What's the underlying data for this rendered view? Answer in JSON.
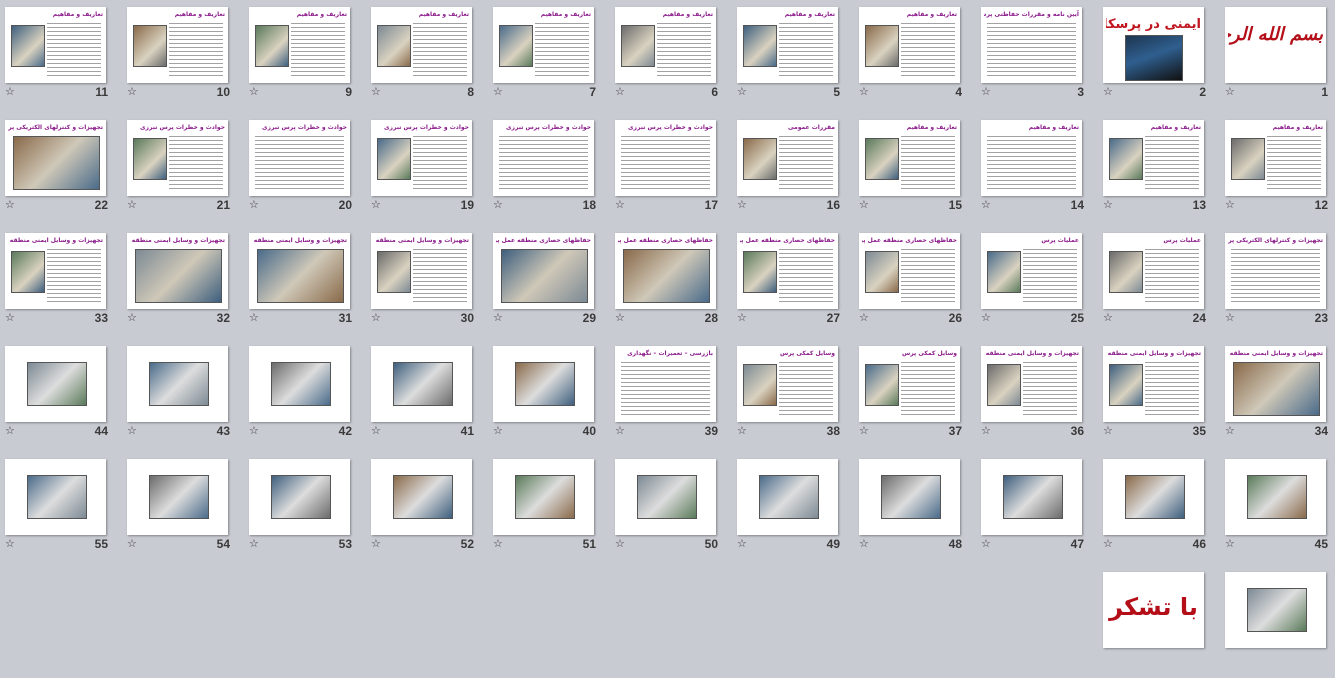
{
  "slides": [
    {
      "n": "1",
      "title": "بسم الله الرحمن الرحیم",
      "kind": "basm"
    },
    {
      "n": "2",
      "title": "ایمنی در پرسکاری",
      "kind": "big"
    },
    {
      "n": "3",
      "title": "آیین نامه و مقررات حفاظتی پرس ها",
      "kind": "text"
    },
    {
      "n": "4",
      "title": "تعاریف و مفاهیم",
      "kind": "mix"
    },
    {
      "n": "5",
      "title": "تعاریف و مفاهیم",
      "kind": "mix"
    },
    {
      "n": "6",
      "title": "تعاریف و مفاهیم",
      "kind": "mix"
    },
    {
      "n": "7",
      "title": "تعاریف و مفاهیم",
      "kind": "mix"
    },
    {
      "n": "8",
      "title": "تعاریف و مفاهیم",
      "kind": "mix"
    },
    {
      "n": "9",
      "title": "تعاریف و مفاهیم",
      "kind": "mix"
    },
    {
      "n": "10",
      "title": "تعاریف و مفاهیم",
      "kind": "mix"
    },
    {
      "n": "11",
      "title": "تعاریف و مفاهیم",
      "kind": "mix"
    },
    {
      "n": "12",
      "title": "تعاریف و مفاهیم",
      "kind": "mix"
    },
    {
      "n": "13",
      "title": "تعاریف و مفاهیم",
      "kind": "mix"
    },
    {
      "n": "14",
      "title": "تعاریف و مفاهیم",
      "kind": "text"
    },
    {
      "n": "15",
      "title": "تعاریف و مفاهیم",
      "kind": "mix"
    },
    {
      "n": "16",
      "title": "مقررات عمومی",
      "kind": "mix"
    },
    {
      "n": "17",
      "title": "حوادث و خطرات پرس تبرزی",
      "kind": "text"
    },
    {
      "n": "18",
      "title": "حوادث و خطرات پرس تبرزی",
      "kind": "text"
    },
    {
      "n": "19",
      "title": "حوادث و خطرات پرس تبرزی",
      "kind": "mix"
    },
    {
      "n": "20",
      "title": "حوادث و خطرات پرس تبرزی",
      "kind": "text"
    },
    {
      "n": "21",
      "title": "حوادث و خطرات پرس تبرزی",
      "kind": "mix"
    },
    {
      "n": "22",
      "title": "تجهیزات و کنترلهای الکتریکی پرس ها",
      "kind": "img"
    },
    {
      "n": "23",
      "title": "تجهیزات و کنترلهای الکتریکی پرس ها",
      "kind": "text"
    },
    {
      "n": "24",
      "title": "عملیات پرس",
      "kind": "mix"
    },
    {
      "n": "25",
      "title": "عملیات پرس",
      "kind": "mix"
    },
    {
      "n": "26",
      "title": "حفاظهای حصاری منطقه عمل پرس",
      "kind": "mix"
    },
    {
      "n": "27",
      "title": "حفاظهای حصاری منطقه عمل پرس",
      "kind": "mix"
    },
    {
      "n": "28",
      "title": "حفاظهای حصاری منطقه عمل پرس",
      "kind": "img"
    },
    {
      "n": "29",
      "title": "حفاظهای حصاری منطقه عمل پرس",
      "kind": "img"
    },
    {
      "n": "30",
      "title": "تجهیزات و وسایل ایمنی منطقه عمل پرسها",
      "kind": "mix"
    },
    {
      "n": "31",
      "title": "تجهیزات و وسایل ایمنی منطقه عمل پرسها",
      "kind": "img"
    },
    {
      "n": "32",
      "title": "تجهیزات و وسایل ایمنی منطقه عمل پرسها",
      "kind": "img"
    },
    {
      "n": "33",
      "title": "تجهیزات و وسایل ایمنی منطقه عمل پرسها",
      "kind": "mix"
    },
    {
      "n": "34",
      "title": "تجهیزات و وسایل ایمنی منطقه عمل پرسها",
      "kind": "img"
    },
    {
      "n": "35",
      "title": "تجهیزات و وسایل ایمنی منطقه عمل پرسها",
      "kind": "mix"
    },
    {
      "n": "36",
      "title": "تجهیزات و وسایل ایمنی منطقه عمل پرسها",
      "kind": "mix"
    },
    {
      "n": "37",
      "title": "وسایل کمکی پرس",
      "kind": "mix"
    },
    {
      "n": "38",
      "title": "وسایل کمکی پرس",
      "kind": "mix"
    },
    {
      "n": "39",
      "title": "بازرسی – تعمیرات – نگهداری",
      "kind": "text"
    },
    {
      "n": "40",
      "title": "",
      "kind": "photo"
    },
    {
      "n": "41",
      "title": "",
      "kind": "photo"
    },
    {
      "n": "42",
      "title": "",
      "kind": "photo"
    },
    {
      "n": "43",
      "title": "",
      "kind": "photo"
    },
    {
      "n": "44",
      "title": "",
      "kind": "photo"
    },
    {
      "n": "45",
      "title": "",
      "kind": "photo"
    },
    {
      "n": "46",
      "title": "",
      "kind": "photo"
    },
    {
      "n": "47",
      "title": "",
      "kind": "photo"
    },
    {
      "n": "48",
      "title": "",
      "kind": "photo"
    },
    {
      "n": "49",
      "title": "",
      "kind": "photo"
    },
    {
      "n": "50",
      "title": "",
      "kind": "photo"
    },
    {
      "n": "51",
      "title": "",
      "kind": "photo"
    },
    {
      "n": "52",
      "title": "",
      "kind": "photo"
    },
    {
      "n": "53",
      "title": "",
      "kind": "photo"
    },
    {
      "n": "54",
      "title": "",
      "kind": "photo"
    },
    {
      "n": "55",
      "title": "",
      "kind": "photo"
    },
    {
      "n": "",
      "title": "",
      "kind": "photo"
    },
    {
      "n": "",
      "title": "با تشکر",
      "kind": "end"
    }
  ],
  "star_glyph": "☆"
}
